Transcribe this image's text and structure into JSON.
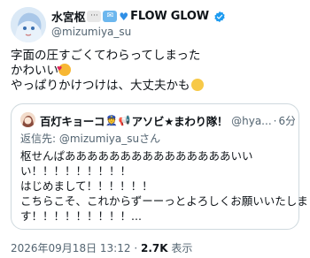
{
  "author": {
    "display_name": "水宮枢",
    "name_suffix": "FLOW GLOW",
    "handle": "@mizumiya_su"
  },
  "tweet": {
    "lines": [
      "字面の圧すごくてわらってしまった",
      "かわいい",
      "やっぱりかけつけは、大丈夫かも"
    ]
  },
  "quote": {
    "display_name": "百灯キョーコ",
    "name_mid": "アソビ★まわり隊！",
    "handle": "@hya...",
    "separator": "·",
    "time": "6分",
    "reply_prefix": "返信先: ",
    "reply_mention": "@mizumiya_su",
    "reply_suffix": "さん",
    "lines": [
      "枢せんぱあああああああああああああああいい",
      "い！！！！！！！！！",
      "はじめまして！！！！！！",
      "こちらこそ、これからずーーっとよろしくお願いいたしま",
      "す！！！！！！！！！..."
    ]
  },
  "meta": {
    "timestamp": "2026年09月18日 13:12",
    "separator": "·",
    "views_count": "2.7K",
    "views_label": "表示"
  },
  "colors": {
    "verified": "#1d9bf0",
    "secondary_text": "#536471",
    "border": "#cfd9de"
  }
}
